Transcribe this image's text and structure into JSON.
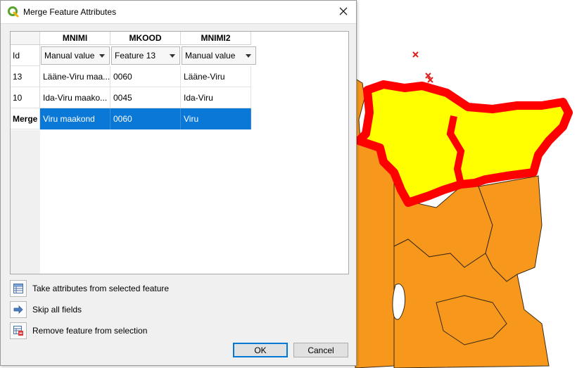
{
  "dialog": {
    "title": "Merge Feature Attributes",
    "close_glyph": "✕"
  },
  "table": {
    "columns": [
      "MNIMI",
      "MKOOD",
      "MNIMI2"
    ],
    "combo_row": {
      "label": "Id",
      "values": [
        "Manual value",
        "Feature 13",
        "Manual value"
      ]
    },
    "rows": [
      {
        "label": "13",
        "cells": [
          "Lääne-Viru maa...",
          "0060",
          "Lääne-Viru"
        ]
      },
      {
        "label": "10",
        "cells": [
          "Ida-Viru maako...",
          "0045",
          "Ida-Viru"
        ]
      }
    ],
    "merge_row": {
      "label": "Merge",
      "cells": [
        "Viru maakond",
        "0060",
        "Viru"
      ]
    }
  },
  "actions": {
    "take_attributes": "Take attributes from selected feature",
    "skip_all": "Skip all fields",
    "remove_feature": "Remove feature from selection"
  },
  "buttons": {
    "ok": "OK",
    "cancel": "Cancel"
  },
  "icons": {
    "app": "qgis-logo-icon",
    "take": "attribute-table-icon",
    "skip": "arrow-right-icon",
    "remove": "remove-from-selection-icon"
  },
  "colors": {
    "selection": "#0a78d7",
    "map_fill_orange": "#f7981d",
    "map_fill_selected": "#ffff00",
    "map_outline_selected": "#ff0000",
    "point_marker": "#e0201c"
  }
}
